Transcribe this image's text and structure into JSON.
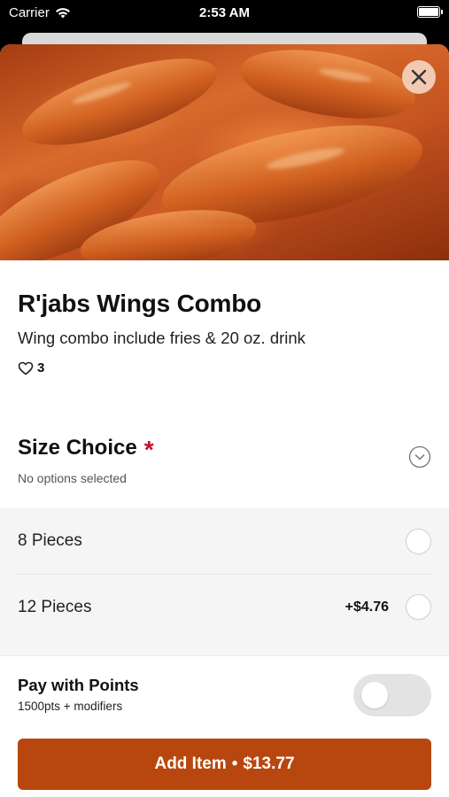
{
  "status_bar": {
    "carrier": "Carrier",
    "time": "2:53 AM",
    "icons": [
      "wifi-icon",
      "battery-icon"
    ]
  },
  "hero": {
    "image": "buffalo-wings-photo",
    "close_icon": "close-icon"
  },
  "item": {
    "title": "R'jabs Wings Combo",
    "description": "Wing combo include fries & 20 oz. drink",
    "likes": "3",
    "like_icon": "heart-outline-icon"
  },
  "size_choice": {
    "title": "Size Choice",
    "required_mark": "*",
    "subtitle": "No options selected",
    "chevron_icon": "chevron-down-circle-icon",
    "options": [
      {
        "label": "8 Pieces",
        "price": "",
        "selected": false
      },
      {
        "label": "12 Pieces",
        "price": "+$4.76",
        "selected": false
      }
    ]
  },
  "pay_with_points": {
    "title": "Pay with Points",
    "subtitle": "1500pts + modifiers",
    "enabled": false
  },
  "cta": {
    "label": "Add Item",
    "separator": "•",
    "price": "$13.77"
  },
  "colors": {
    "accent": "#b8470f",
    "required": "#c8102e",
    "options_bg": "#f5f5f5"
  }
}
